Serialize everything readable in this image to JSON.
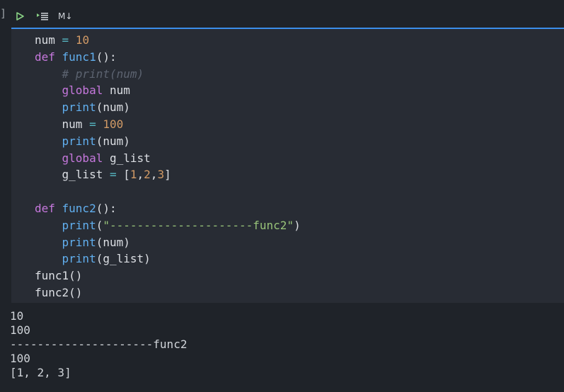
{
  "cell": {
    "bracket": "]",
    "toolbar": {
      "run_icon": "play-icon",
      "run_by_line_icon": "run-by-line-icon",
      "markdown_label": "M↓"
    },
    "code_lines": [
      [
        {
          "t": "num ",
          "c": ""
        },
        {
          "t": "=",
          "c": "op"
        },
        {
          "t": " ",
          "c": ""
        },
        {
          "t": "10",
          "c": "num"
        }
      ],
      [
        {
          "t": "def ",
          "c": "kw"
        },
        {
          "t": "func1",
          "c": "fn"
        },
        {
          "t": "():",
          "c": ""
        }
      ],
      [
        {
          "t": "    ",
          "c": ""
        },
        {
          "t": "# print(num)",
          "c": "com"
        }
      ],
      [
        {
          "t": "    ",
          "c": ""
        },
        {
          "t": "global",
          "c": "kw"
        },
        {
          "t": " num",
          "c": ""
        }
      ],
      [
        {
          "t": "    ",
          "c": ""
        },
        {
          "t": "print",
          "c": "fn"
        },
        {
          "t": "(num)",
          "c": ""
        }
      ],
      [
        {
          "t": "    num ",
          "c": ""
        },
        {
          "t": "=",
          "c": "op"
        },
        {
          "t": " ",
          "c": ""
        },
        {
          "t": "100",
          "c": "num"
        }
      ],
      [
        {
          "t": "    ",
          "c": ""
        },
        {
          "t": "print",
          "c": "fn"
        },
        {
          "t": "(num)",
          "c": ""
        }
      ],
      [
        {
          "t": "    ",
          "c": ""
        },
        {
          "t": "global",
          "c": "kw"
        },
        {
          "t": " g_list",
          "c": ""
        }
      ],
      [
        {
          "t": "    g_list ",
          "c": ""
        },
        {
          "t": "=",
          "c": "op"
        },
        {
          "t": " [",
          "c": ""
        },
        {
          "t": "1",
          "c": "num"
        },
        {
          "t": ",",
          "c": ""
        },
        {
          "t": "2",
          "c": "num"
        },
        {
          "t": ",",
          "c": ""
        },
        {
          "t": "3",
          "c": "num"
        },
        {
          "t": "]",
          "c": ""
        }
      ],
      [
        {
          "t": "",
          "c": ""
        }
      ],
      [
        {
          "t": "def ",
          "c": "kw"
        },
        {
          "t": "func2",
          "c": "fn"
        },
        {
          "t": "():",
          "c": ""
        }
      ],
      [
        {
          "t": "    ",
          "c": ""
        },
        {
          "t": "print",
          "c": "fn"
        },
        {
          "t": "(",
          "c": ""
        },
        {
          "t": "\"---------------------func2\"",
          "c": "str"
        },
        {
          "t": ")",
          "c": ""
        }
      ],
      [
        {
          "t": "    ",
          "c": ""
        },
        {
          "t": "print",
          "c": "fn"
        },
        {
          "t": "(num)",
          "c": ""
        }
      ],
      [
        {
          "t": "    ",
          "c": ""
        },
        {
          "t": "print",
          "c": "fn"
        },
        {
          "t": "(g_list)",
          "c": ""
        }
      ],
      [
        {
          "t": "func1()",
          "c": ""
        }
      ],
      [
        {
          "t": "func2()",
          "c": ""
        }
      ]
    ],
    "output_lines": [
      "10",
      "100",
      "---------------------func2",
      "100",
      "[1, 2, 3]"
    ]
  },
  "colors": {
    "background": "#1f2329",
    "editor_background": "#282c34",
    "focus_border": "#3b8eea",
    "run_icon": "#89d185"
  }
}
